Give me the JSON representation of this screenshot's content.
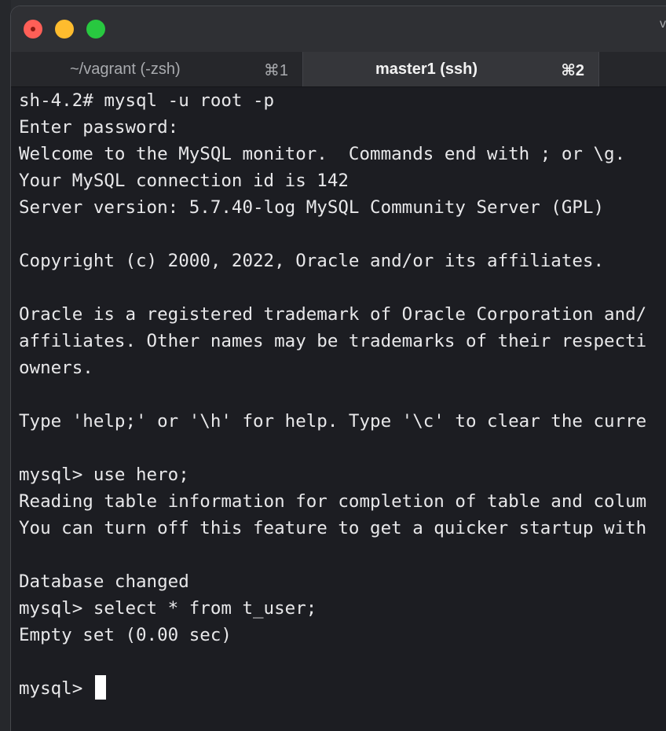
{
  "window": {
    "title_edge": "v"
  },
  "tabs": [
    {
      "label": "~/vagrant (-zsh)",
      "shortcut": "⌘1",
      "active": false
    },
    {
      "label": "master1 (ssh)",
      "shortcut": "⌘2",
      "active": true
    }
  ],
  "terminal": {
    "lines": [
      "sh-4.2# mysql -u root -p",
      "Enter password:",
      "Welcome to the MySQL monitor.  Commands end with ; or \\g.",
      "Your MySQL connection id is 142",
      "Server version: 5.7.40-log MySQL Community Server (GPL)",
      "",
      "Copyright (c) 2000, 2022, Oracle and/or its affiliates.",
      "",
      "Oracle is a registered trademark of Oracle Corporation and/",
      "affiliates. Other names may be trademarks of their respecti",
      "owners.",
      "",
      "Type 'help;' or '\\h' for help. Type '\\c' to clear the curre",
      "",
      "mysql> use hero;",
      "Reading table information for completion of table and colum",
      "You can turn off this feature to get a quicker startup with",
      "",
      "Database changed",
      "mysql> select * from t_user;",
      "Empty set (0.00 sec)",
      ""
    ],
    "prompt": "mysql> "
  },
  "colors": {
    "background": "#1c1d22",
    "text": "#e8e8ea",
    "titlebar": "#2f3034",
    "close": "#ff5f57",
    "minimize": "#febc2e",
    "maximize": "#28c840"
  }
}
